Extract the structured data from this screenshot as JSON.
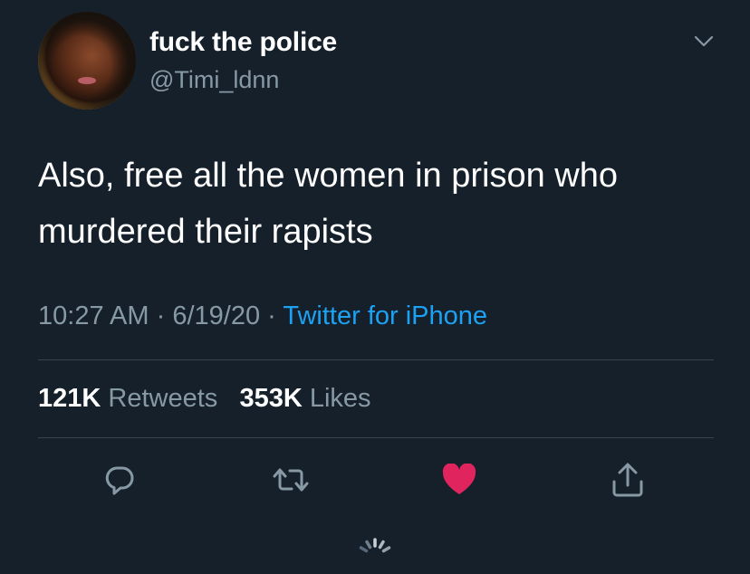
{
  "user": {
    "display_name": "fuck the police",
    "handle": "@Timi_ldnn"
  },
  "tweet": {
    "text": "Also, free all the women in prison who murdered their rapists",
    "time": "10:27 AM",
    "separator": "·",
    "date": "6/19/20",
    "source": "Twitter for iPhone"
  },
  "stats": {
    "retweets_count": "121K",
    "retweets_label": "Retweets",
    "likes_count": "353K",
    "likes_label": "Likes"
  },
  "actions": {
    "reply_icon": "reply-icon",
    "retweet_icon": "retweet-icon",
    "like_icon": "heart-icon",
    "share_icon": "share-icon",
    "like_active": true
  },
  "colors": {
    "background": "#15202b",
    "secondary_text": "#8899a6",
    "link": "#1da1f2",
    "like": "#e0245e",
    "divider": "#38444d"
  }
}
